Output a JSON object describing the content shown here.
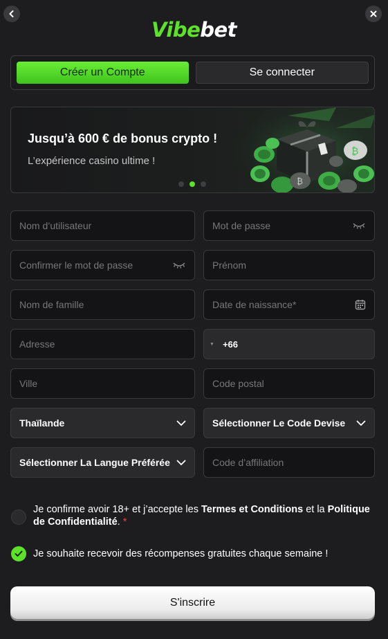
{
  "logo": {
    "part1": "Vibe",
    "part2": "bet"
  },
  "tabs": {
    "register": "Créer un Compte",
    "login": "Se connecter"
  },
  "banner": {
    "title": "Jusqu’à 600 € de bonus crypto !",
    "subtitle": "L’expérience casino ultime !",
    "slide_count": 3,
    "active_slide": 2
  },
  "form": {
    "username": "Nom d’utilisateur",
    "password": "Mot de passe",
    "confirm_password": "Confirmer le mot de passe",
    "first_name": "Prénom",
    "last_name": "Nom de famille",
    "birth_date": "Date de naissance*",
    "address": "Adresse",
    "phone_code": "+66",
    "city": "Ville",
    "postal_code": "Code postal",
    "country": "Thaïlande",
    "currency": "Sélectionner Le Code Devise",
    "language": "Sélectionner La Langue Préférée",
    "affiliate": "Code d’affiliation"
  },
  "consent": {
    "terms_prefix": "Je confirme avoir 18+ et j’accepte les ",
    "terms_link": "Termes et Conditions",
    "terms_middle": " et la ",
    "privacy_link": "Politique de Confidentialité",
    "terms_suffix": ". ",
    "required_mark": "*",
    "rewards": "Je souhaite recevoir des récompenses gratuites chaque semaine !"
  },
  "submit_label": "S'inscrire",
  "colors": {
    "accent": "#5ee12a",
    "background": "#1d1d1f",
    "field": "#141416"
  }
}
